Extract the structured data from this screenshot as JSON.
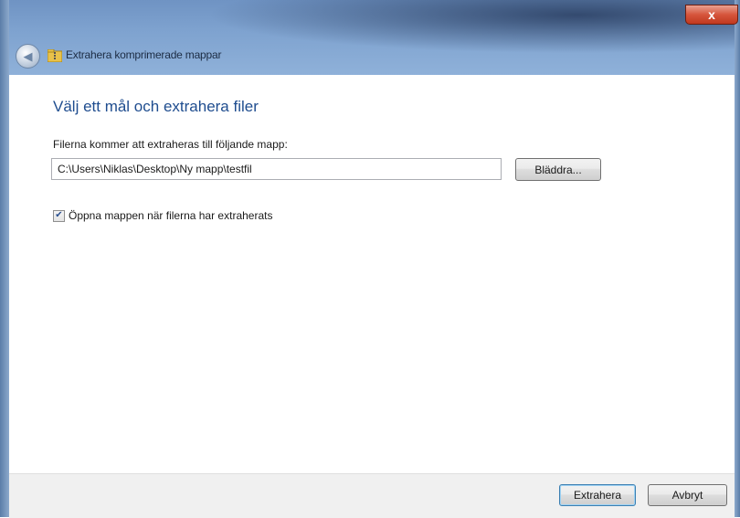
{
  "window": {
    "title": "Extrahera komprimerade mappar",
    "close_symbol": "x",
    "back_icon": "back-arrow-icon",
    "folder_icon": "zip-folder-icon"
  },
  "content": {
    "heading": "Välj ett mål och extrahera filer",
    "path_label": "Filerna kommer att extraheras till följande mapp:",
    "path_value": "C:\\Users\\Niklas\\Desktop\\Ny mapp\\testfil",
    "browse_label": "Bläddra...",
    "checkbox_label": "Öppna mappen när filerna har extraherats",
    "checkbox_checked": true
  },
  "footer": {
    "extract_label": "Extrahera",
    "cancel_label": "Avbryt"
  },
  "colors": {
    "heading": "#1f4d8f",
    "titlebar": "#7ea2cf",
    "close": "#c0391f"
  }
}
